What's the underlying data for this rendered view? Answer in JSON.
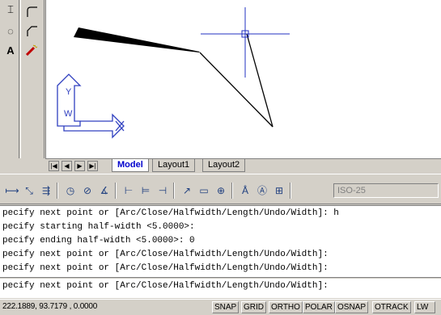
{
  "tabs": {
    "nav": [
      "|◀",
      "◀",
      "▶",
      "▶|"
    ],
    "items": [
      {
        "label": "Model",
        "active": true
      },
      {
        "label": "Layout1",
        "active": false
      },
      {
        "label": "Layout2",
        "active": false
      }
    ]
  },
  "dim_toolbar": {
    "icons": [
      "linear-dim-icon",
      "aligned-dim-icon",
      "ordinate-dim-icon",
      "radius-dim-icon",
      "diameter-dim-icon",
      "angular-dim-icon",
      "quick-dim-icon",
      "baseline-dim-icon",
      "continue-dim-icon",
      "leader-icon",
      "tolerance-icon",
      "center-mark-icon",
      "dim-edit-icon",
      "dim-text-edit-icon",
      "dim-update-icon"
    ],
    "style_value": "ISO-25"
  },
  "command_lines": [
    "pecify next point or [Arc/Close/Halfwidth/Length/Undo/Width]: h",
    "pecify starting half-width <5.0000>:",
    "pecify ending half-width <5.0000>: 0",
    "pecify next point or [Arc/Close/Halfwidth/Length/Undo/Width]:",
    "pecify next point or [Arc/Close/Halfwidth/Length/Undo/Width]:",
    "pecify next point or [Arc/Close/Halfwidth/Length/Undo/Width]:"
  ],
  "status": {
    "coordinates": "222.1889, 93.7179 , 0.0000",
    "buttons": [
      "SNAP",
      "GRID",
      "ORTHO",
      "POLAR",
      "OSNAP",
      "OTRACK",
      "LW"
    ]
  },
  "ucs": {
    "y_label": "Y",
    "w_label": "W"
  },
  "colors": {
    "crosshair": "#2030c0",
    "ucs": "#3040c0",
    "active_tab": "#0000cc"
  }
}
